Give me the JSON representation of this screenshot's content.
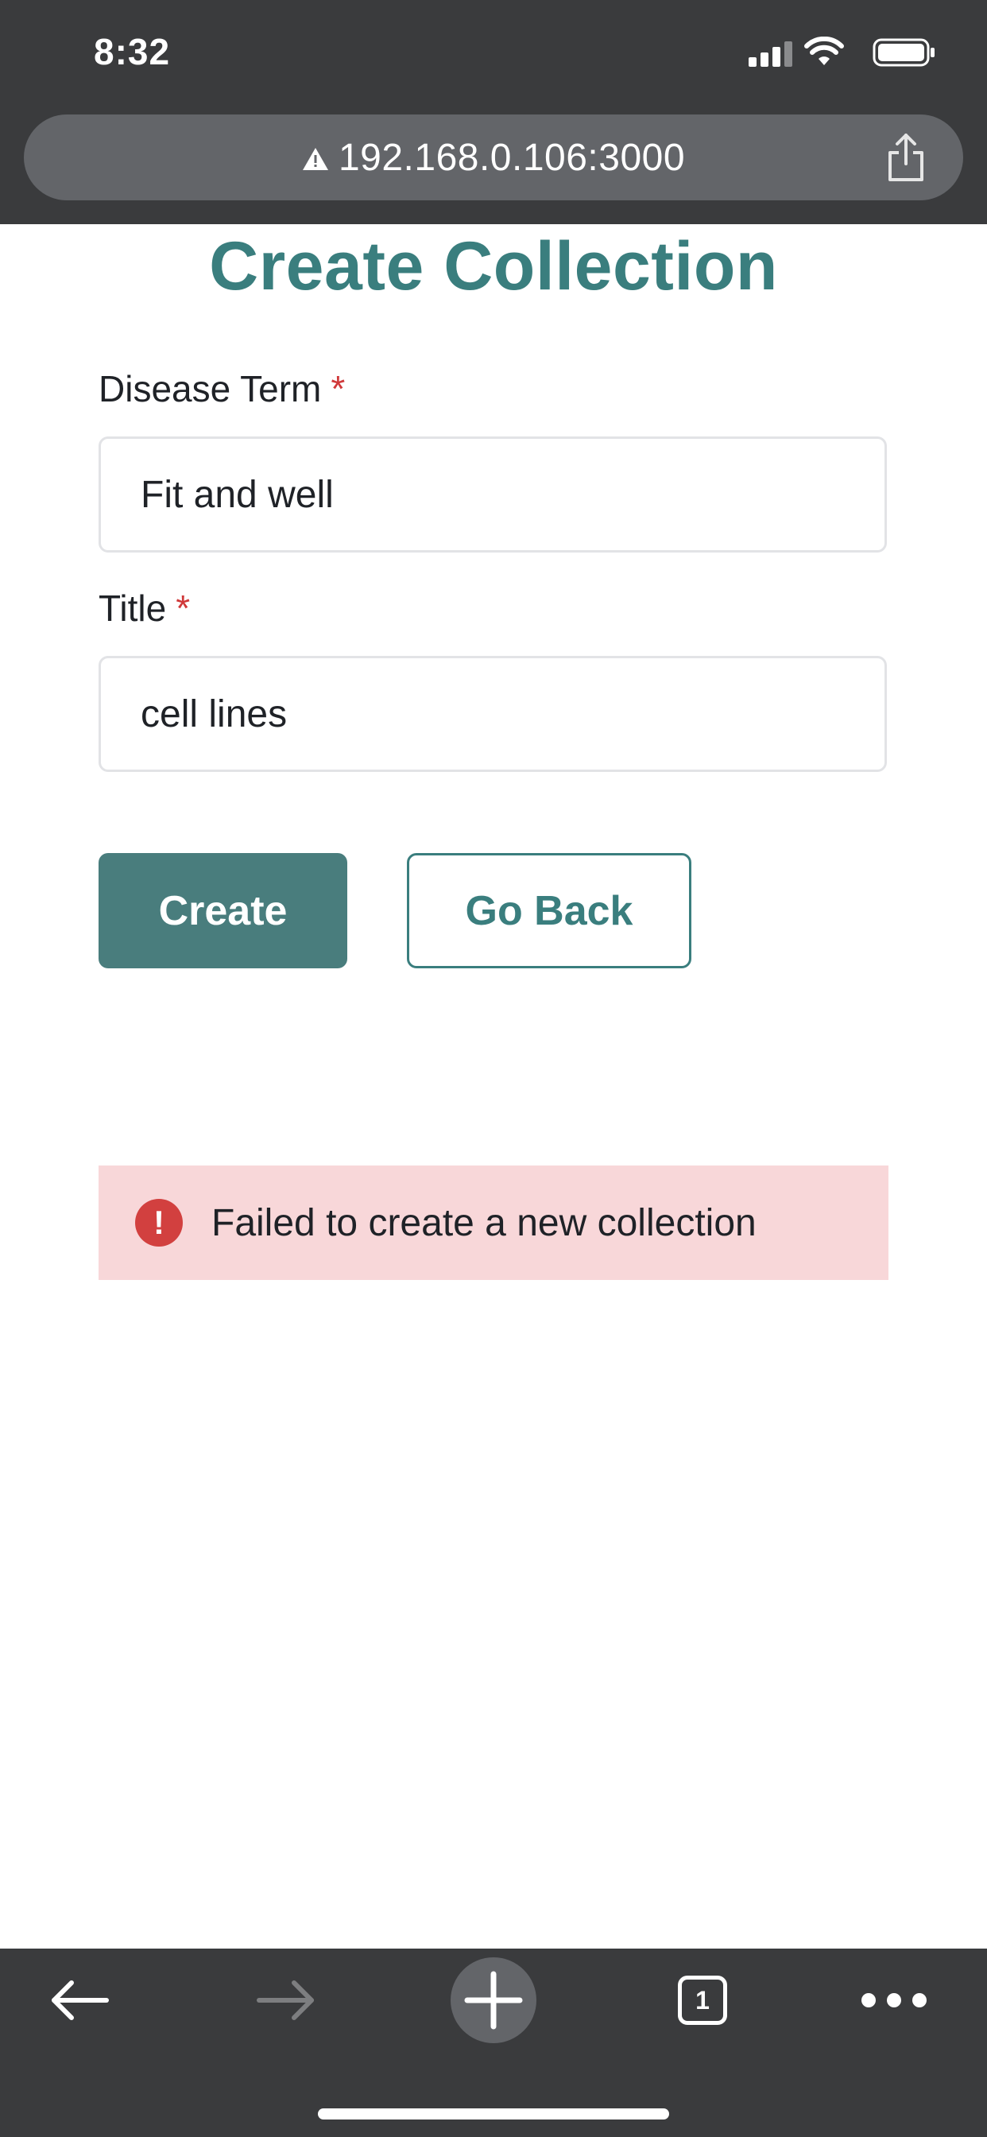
{
  "status_bar": {
    "time": "8:32"
  },
  "browser": {
    "url": "192.168.0.106:3000",
    "tab_count": "1"
  },
  "page": {
    "title": "Create Collection",
    "disease_term": {
      "label": "Disease Term",
      "required_mark": "*",
      "value": "Fit and well"
    },
    "title_field": {
      "label": "Title",
      "required_mark": "*",
      "value": "cell lines"
    },
    "create_label": "Create",
    "back_label": "Go Back",
    "alert": {
      "icon": "!",
      "message": "Failed to create a new collection"
    }
  },
  "colors": {
    "accent": "#3a7e7e",
    "primary_button": "#497d7d",
    "required": "#d0393a",
    "alert_bg": "#f8d7d9",
    "alert_icon": "#d2403f",
    "chrome": "#3a3b3d"
  },
  "icons": [
    "warning-icon",
    "share-icon",
    "back-arrow-icon",
    "forward-arrow-icon",
    "new-tab-icon",
    "tabs-icon",
    "more-icon",
    "cell-signal-icon",
    "wifi-icon",
    "battery-icon"
  ]
}
